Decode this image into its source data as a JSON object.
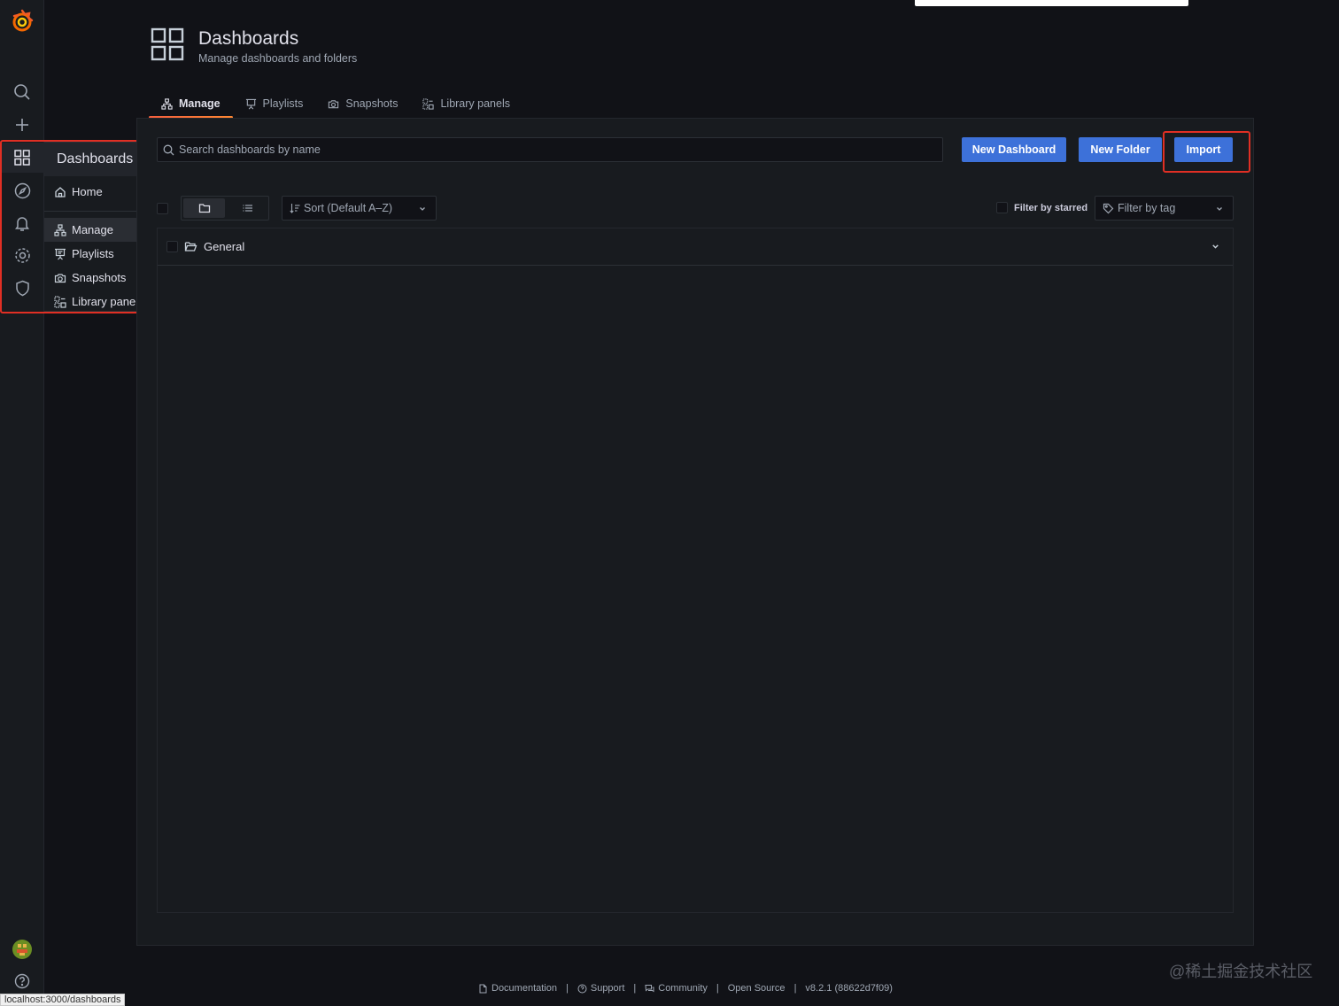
{
  "header": {
    "title": "Dashboards",
    "subtitle": "Manage dashboards and folders",
    "icon": "dashboards-grid-icon"
  },
  "tabs": [
    {
      "label": "Manage",
      "icon": "sitemap-icon",
      "active": true
    },
    {
      "label": "Playlists",
      "icon": "presentation-icon",
      "active": false
    },
    {
      "label": "Snapshots",
      "icon": "camera-icon",
      "active": false
    },
    {
      "label": "Library panels",
      "icon": "library-panel-icon",
      "active": false
    }
  ],
  "sidebar": {
    "icons": [
      "grafana-logo",
      "search-icon",
      "plus-icon",
      "dashboards-icon",
      "compass-icon",
      "bell-icon",
      "gear-icon",
      "shield-icon",
      "avatar",
      "help-icon"
    ],
    "flyout": {
      "title": "Dashboards",
      "items": [
        {
          "label": "Home",
          "icon": "home-icon"
        },
        {
          "label": "Manage",
          "icon": "sitemap-icon",
          "active": true
        },
        {
          "label": "Playlists",
          "icon": "presentation-icon"
        },
        {
          "label": "Snapshots",
          "icon": "camera-icon"
        },
        {
          "label": "Library panels",
          "icon": "library-panel-icon"
        }
      ]
    }
  },
  "search": {
    "placeholder": "Search dashboards by name",
    "value": ""
  },
  "buttons": {
    "new_dashboard": "New Dashboard",
    "new_folder": "New Folder",
    "import": "Import"
  },
  "actions": {
    "sort_label": "Sort (Default A–Z)",
    "filter_starred_label": "Filter by starred",
    "filter_tag_placeholder": "Filter by tag"
  },
  "results": {
    "folders": [
      {
        "name": "General"
      }
    ]
  },
  "footer": {
    "documentation": "Documentation",
    "support": "Support",
    "community": "Community",
    "open_source": "Open Source",
    "version": "v8.2.1 (88622d7f09)",
    "separator": "|"
  },
  "watermark": "@稀土掘金技术社区",
  "statusbar": "localhost:3000/dashboards",
  "colors": {
    "background": "#111217",
    "panel": "#181b1f",
    "primary": "#3d71d9",
    "highlight_border": "#e02f24",
    "tab_active": "#ff8833"
  }
}
